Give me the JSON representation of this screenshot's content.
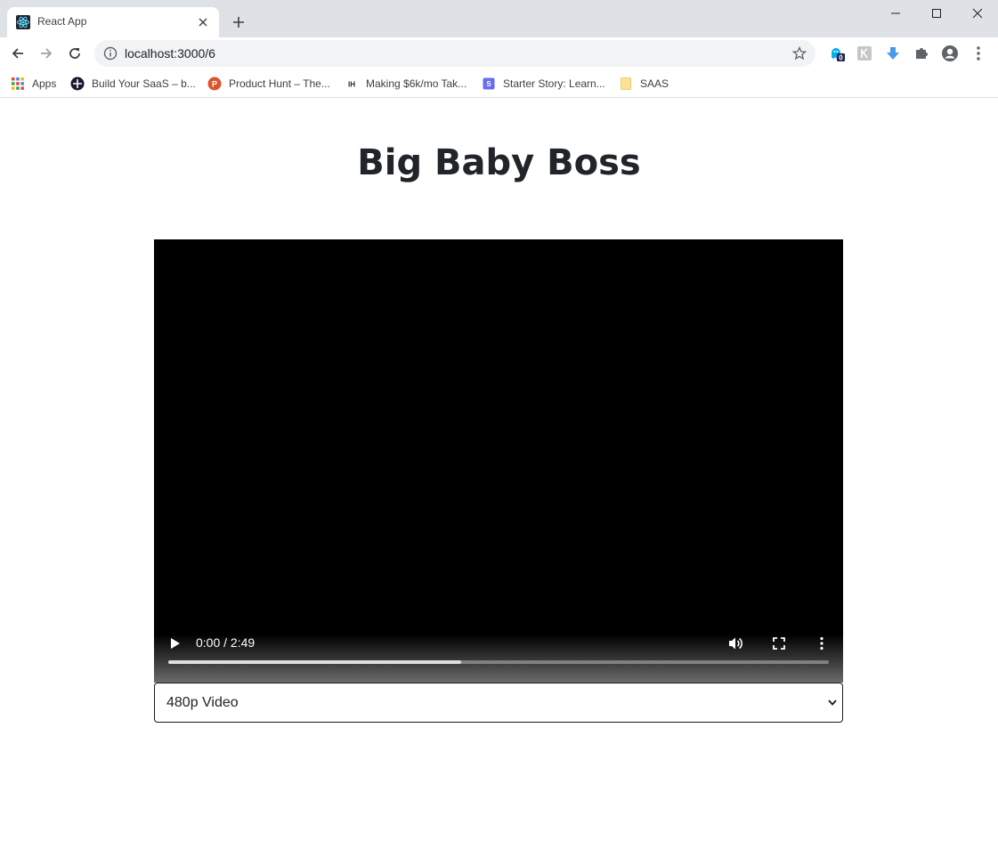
{
  "browser": {
    "tab": {
      "title": "React App",
      "favicon": "react-logo-icon"
    },
    "url": "localhost:3000/6",
    "extension_badge": "0",
    "bookmarks": [
      {
        "label": "Apps",
        "icon": "apps-grid-icon"
      },
      {
        "label": "Build Your SaaS – b...",
        "icon": "build-saas-icon"
      },
      {
        "label": "Product Hunt – The...",
        "icon": "product-hunt-icon"
      },
      {
        "label": "Making $6k/mo Tak...",
        "icon": "indie-hackers-icon"
      },
      {
        "label": "Starter Story: Learn...",
        "icon": "starter-story-icon"
      },
      {
        "label": "SAAS",
        "icon": "folder-icon"
      }
    ],
    "colors": {
      "chrome_bg": "#dee1e6",
      "accent_download": "#4a9be6",
      "react_blue": "#61dafb"
    }
  },
  "page": {
    "title": "Big Baby Boss",
    "video": {
      "time_display": "0:00 / 2:49",
      "buffered_fraction": 0.444,
      "state": "paused"
    },
    "quality_select": {
      "selected": "480p Video"
    }
  }
}
